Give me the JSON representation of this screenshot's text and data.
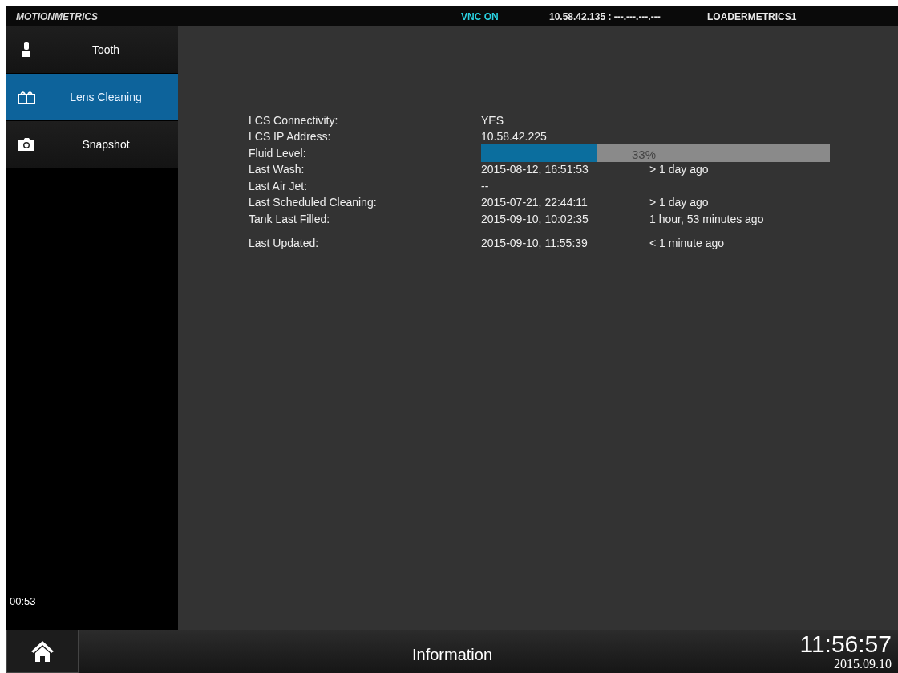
{
  "header": {
    "logo": "MOTIONMETRICS",
    "vnc_status": "VNC ON",
    "ip": "10.58.42.135 : ---.---.---.---",
    "device": "LOADERMETRICS1"
  },
  "sidebar": {
    "items": [
      {
        "label": "Tooth",
        "kind": "tooth",
        "selected": false
      },
      {
        "label": "Lens Cleaning",
        "kind": "lens",
        "selected": true
      },
      {
        "label": "Snapshot",
        "kind": "camera",
        "selected": false
      }
    ],
    "timer": "00:53"
  },
  "details": [
    {
      "kind": "text",
      "label": "LCS Connectivity:",
      "value": "YES"
    },
    {
      "kind": "text",
      "label": "LCS IP Address:",
      "value": "10.58.42.225"
    },
    {
      "kind": "bar",
      "label": "Fluid Level:",
      "level": 0.33,
      "reading": "33%"
    },
    {
      "kind": "text",
      "label": "Last Wash:",
      "value": "2015-08-12, 16:51:53",
      "ago": "> 1 day ago"
    },
    {
      "kind": "text",
      "label": "Last Air Jet:",
      "value": "--"
    },
    {
      "kind": "text",
      "label": "Last Scheduled Cleaning:",
      "value": "2015-07-21, 22:44:11",
      "ago": "> 1 day ago"
    },
    {
      "kind": "text",
      "label": "Tank Last Filled:",
      "value": "2015-09-10, 10:02:35",
      "ago": "1 hour, 53 minutes ago"
    },
    {
      "kind": "spacer"
    },
    {
      "kind": "text",
      "label": "Last Updated:",
      "value": "2015-09-10, 11:55:39",
      "ago": "< 1 minute ago"
    }
  ],
  "footer": {
    "title": "Information",
    "time": "11:56:57",
    "date": "2015.09.10"
  }
}
